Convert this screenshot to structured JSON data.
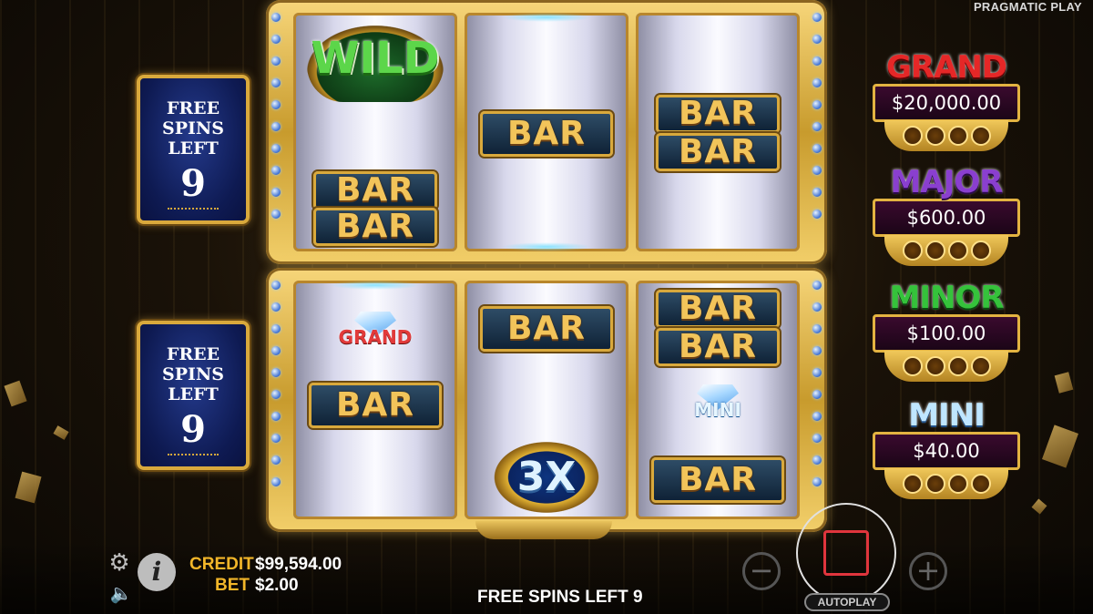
{
  "brand": "PRAGMATIC PLAY",
  "free_spins_panels": [
    {
      "label_line1": "FREE",
      "label_line2": "SPINS LEFT",
      "count": "9"
    },
    {
      "label_line1": "FREE",
      "label_line2": "SPINS LEFT",
      "count": "9"
    }
  ],
  "reels": {
    "top": {
      "r1": [
        "WILD",
        "BAR",
        "BAR"
      ],
      "r2": [
        "BAR"
      ],
      "r3": [
        "BAR",
        "BAR"
      ]
    },
    "bottom": {
      "r1": [
        "GRAND",
        "BAR"
      ],
      "r2": [
        "BAR",
        "3X"
      ],
      "r3": [
        "BAR",
        "BAR",
        "MINI",
        "BAR"
      ]
    }
  },
  "symbols": {
    "wild": "WILD",
    "bar": "BAR",
    "grand": "GRAND",
    "mini": "MINI",
    "multiplier": "3X"
  },
  "jackpots": [
    {
      "name": "GRAND",
      "value": "$20,000.00",
      "color": "#e52727"
    },
    {
      "name": "MAJOR",
      "value": "$600.00",
      "color": "#8a3fcf"
    },
    {
      "name": "MINOR",
      "value": "$100.00",
      "color": "#35c23b"
    },
    {
      "name": "MINI",
      "value": "$40.00",
      "color": "#bfe6ff"
    }
  ],
  "status": {
    "credit_label": "CREDIT",
    "credit_value": "$99,594.00",
    "bet_label": "BET",
    "bet_value": "$2.00",
    "free_spins_text": "FREE SPINS LEFT 9"
  },
  "controls": {
    "info": "i",
    "minus": "−",
    "plus": "+",
    "autoplay": "AUTOPLAY",
    "icons": [
      "gear-icon",
      "speaker-icon",
      "info-icon",
      "minus-icon",
      "plus-icon",
      "stop-icon"
    ]
  }
}
